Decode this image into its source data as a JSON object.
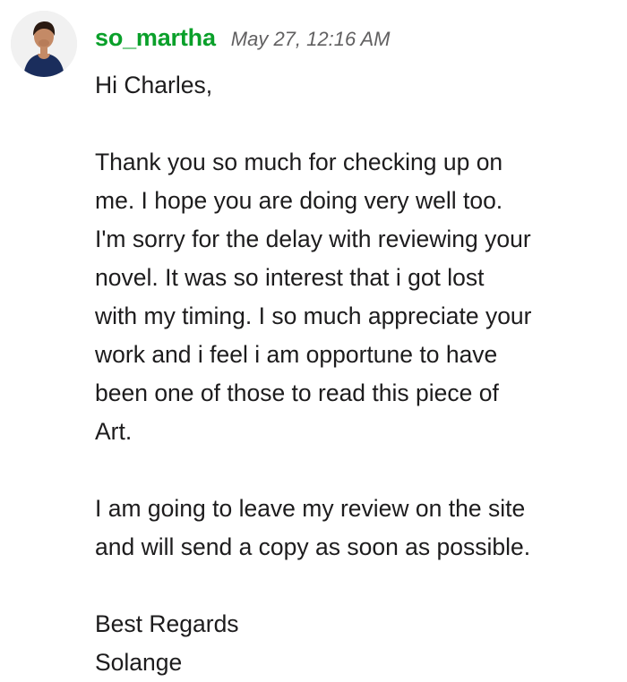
{
  "message": {
    "author": "so_martha",
    "timestamp": "May 27, 12:16 AM",
    "avatar_icon": "user-avatar-photo",
    "author_color": "#0aa02a",
    "greeting": "Hi Charles,",
    "paragraph1": [
      "Thank you so much for checking up on",
      "me. I hope you are doing very well too.",
      "I'm sorry for the delay with reviewing your",
      "novel. It was so interest that i got lost",
      "with my timing. I so much appreciate your",
      "work and i feel i am opportune to have",
      "been one of those to read this piece of",
      "Art."
    ],
    "paragraph2": [
      "I am going to leave my review on the site",
      "and will send a copy as soon as possible."
    ],
    "closing": "Best Regards",
    "signature": "Solange"
  }
}
